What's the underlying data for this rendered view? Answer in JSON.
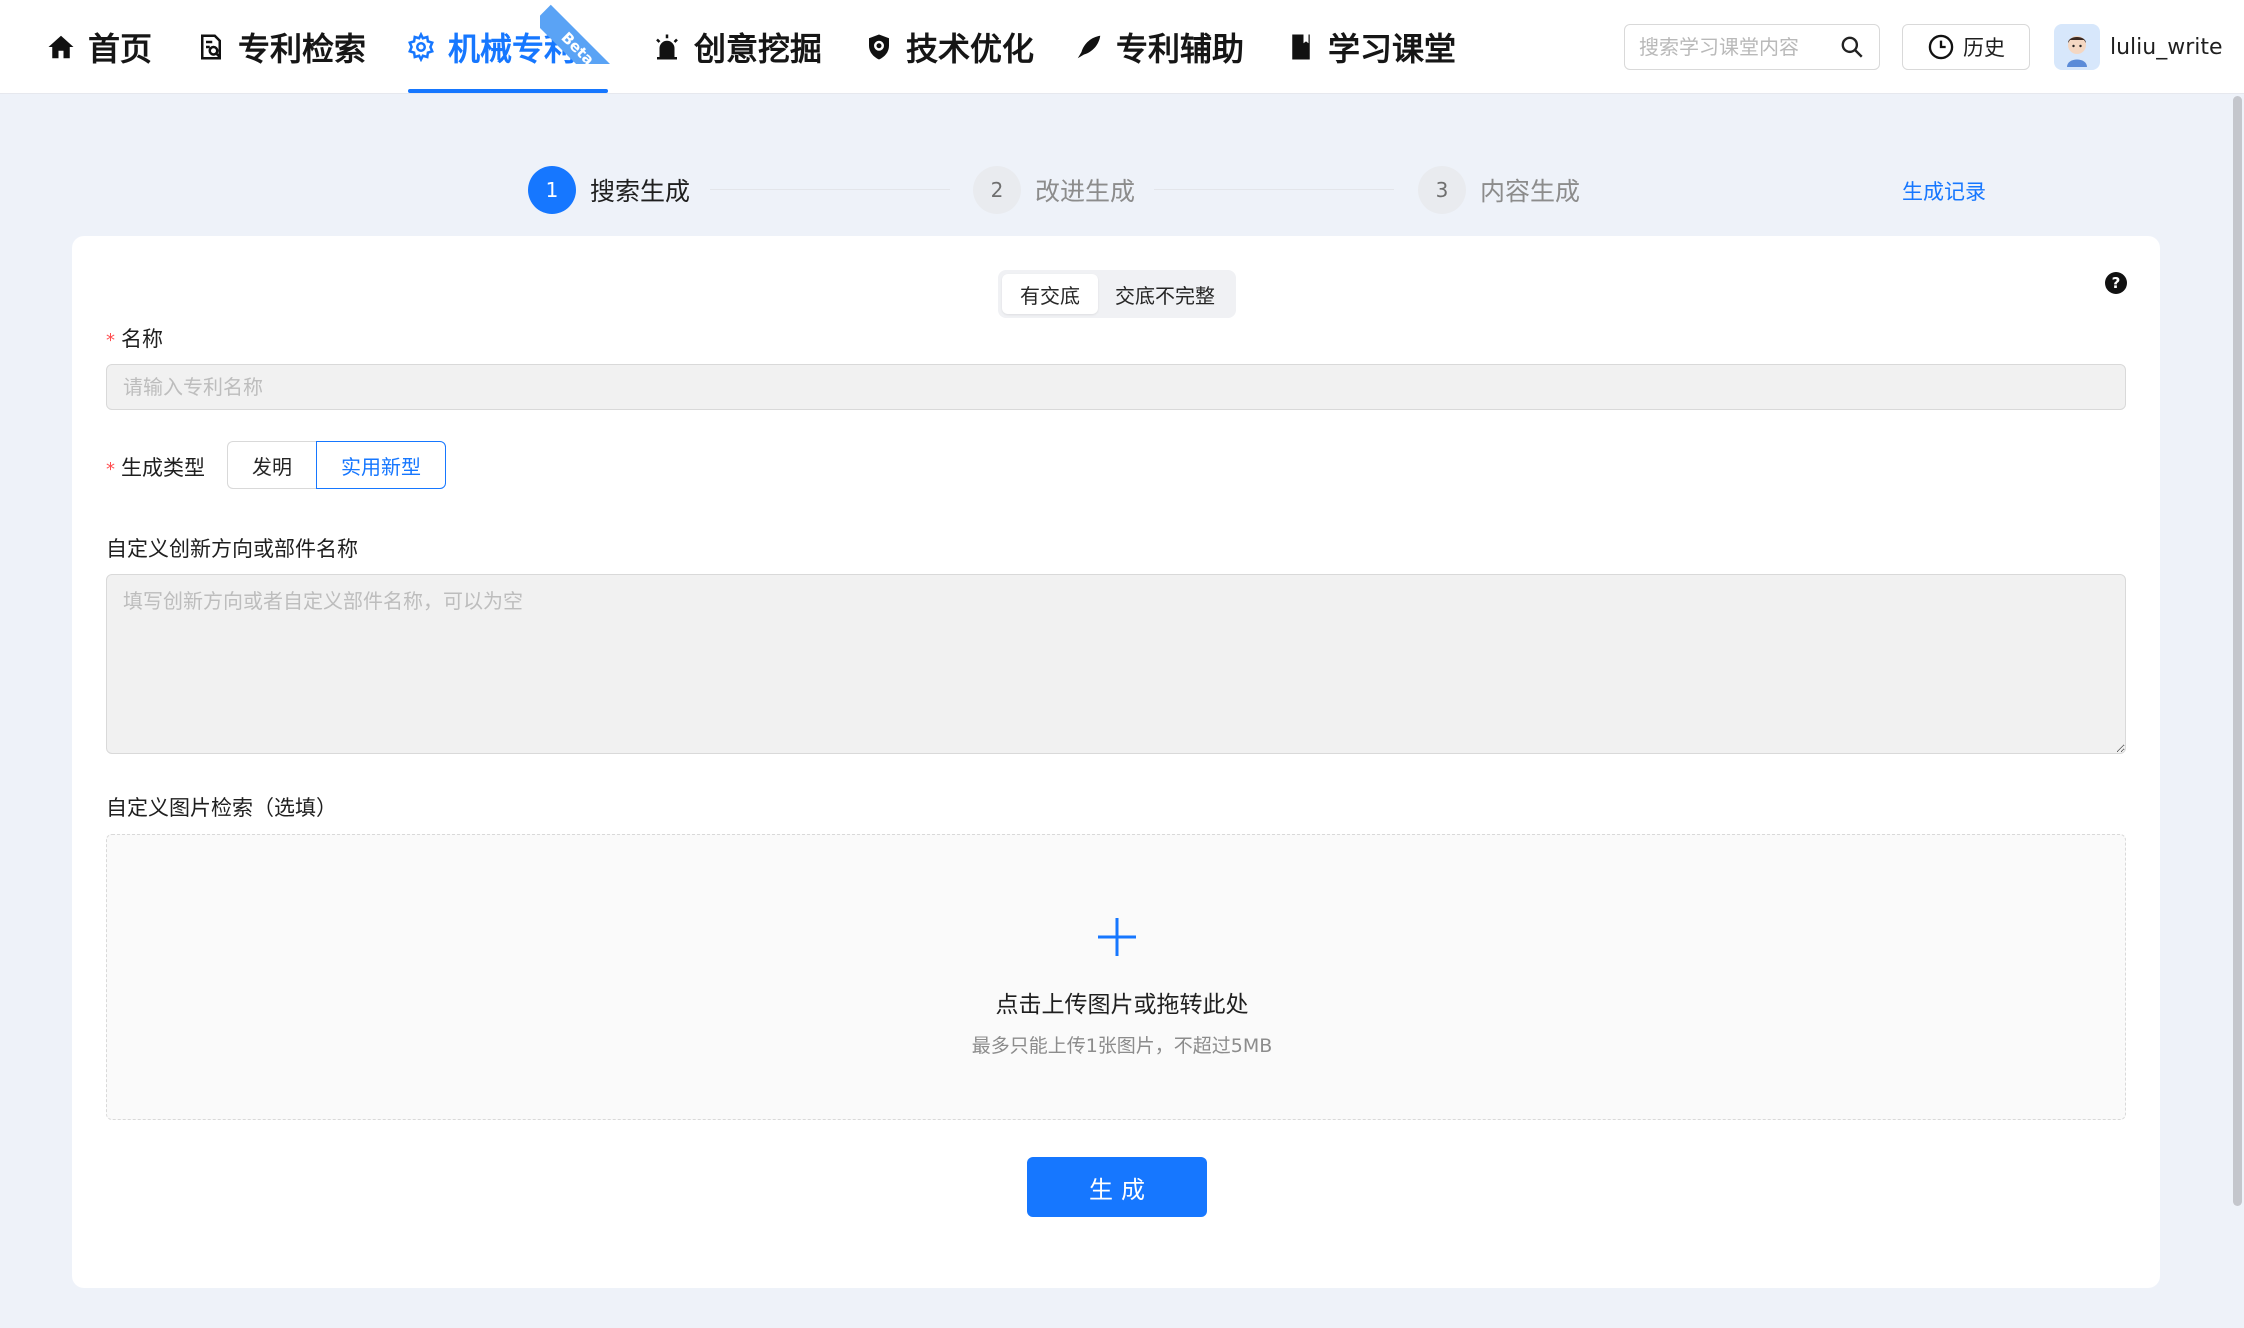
{
  "nav": {
    "items": [
      {
        "label": "首页",
        "icon": "home-icon"
      },
      {
        "label": "专利检索",
        "icon": "document-search-icon"
      },
      {
        "label": "机械专利",
        "icon": "gear-icon"
      },
      {
        "label": "创意挖掘",
        "icon": "alarm-light-icon"
      },
      {
        "label": "技术优化",
        "icon": "shield-icon"
      },
      {
        "label": "专利辅助",
        "icon": "quill-icon"
      },
      {
        "label": "学习课堂",
        "icon": "book-icon"
      }
    ],
    "active_index": 2,
    "beta_badge": "Beta",
    "accent_color": "#1677ff"
  },
  "search": {
    "placeholder": "搜索学习课堂内容",
    "icon": "search-icon"
  },
  "history": {
    "label": "历史",
    "icon": "clock-icon"
  },
  "user": {
    "name": "luliu_write"
  },
  "steps": [
    {
      "number": "1",
      "label": "搜索生成",
      "active": true
    },
    {
      "number": "2",
      "label": "改进生成",
      "active": false
    },
    {
      "number": "3",
      "label": "内容生成",
      "active": false
    }
  ],
  "generation_record_label": "生成记录",
  "mode_toggle": {
    "options": [
      "有交底",
      "交底不完整"
    ],
    "selected": "有交底"
  },
  "help_icon": "?",
  "form": {
    "name_label": "名称",
    "name_placeholder": "请输入专利名称",
    "name_value": "",
    "type_label": "生成类型",
    "type_options": [
      "发明",
      "实用新型"
    ],
    "type_selected": "实用新型",
    "custom_label": "自定义创新方向或部件名称",
    "custom_placeholder": "填写创新方向或者自定义部件名称，可以为空",
    "image_label": "自定义图片检索（选填）",
    "upload_title": "点击上传图片或拖转此处",
    "upload_hint": "最多只能上传1张图片，不超过5MB",
    "submit_label": "生成"
  }
}
